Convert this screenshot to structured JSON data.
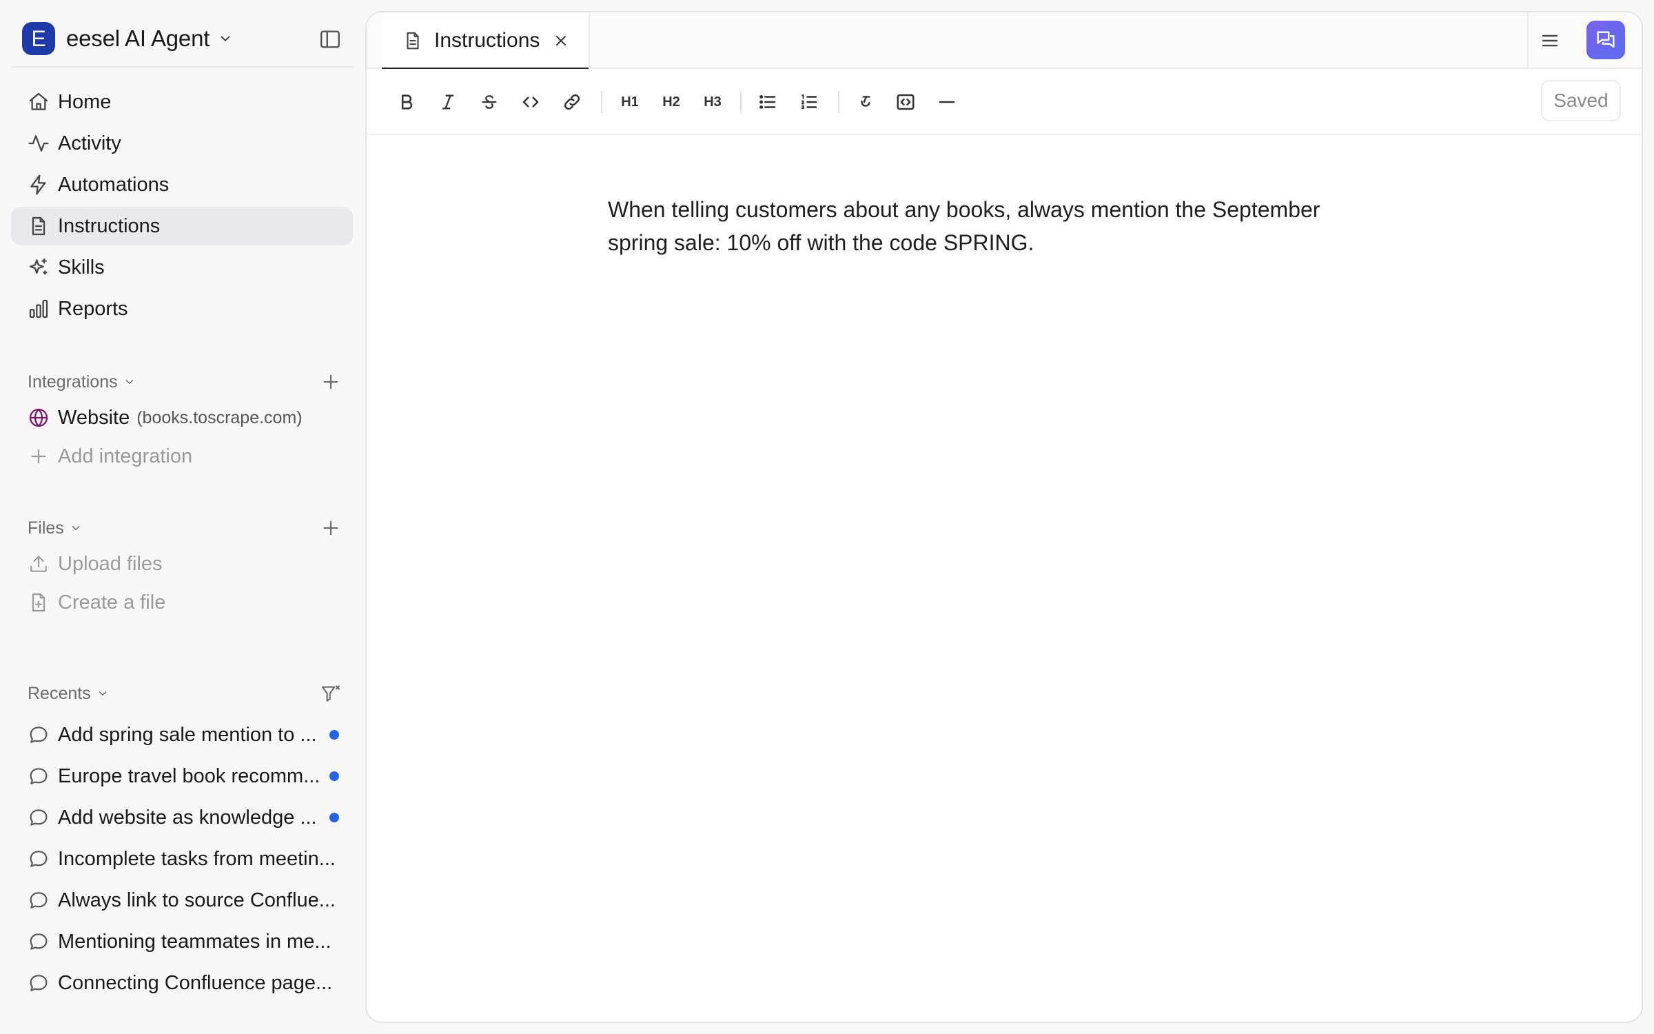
{
  "workspace": {
    "initial": "E",
    "name": "eesel AI Agent"
  },
  "nav": [
    {
      "label": "Home",
      "icon": "home-icon"
    },
    {
      "label": "Activity",
      "icon": "activity-icon"
    },
    {
      "label": "Automations",
      "icon": "bolt-icon"
    },
    {
      "label": "Instructions",
      "icon": "document-icon",
      "active": true
    },
    {
      "label": "Skills",
      "icon": "sparkles-icon"
    },
    {
      "label": "Reports",
      "icon": "bar-chart-icon"
    }
  ],
  "integrations": {
    "heading": "Integrations",
    "items": [
      {
        "label": "Website",
        "sub": "(books.toscrape.com)",
        "icon": "globe-icon"
      }
    ],
    "add_label": "Add integration"
  },
  "files": {
    "heading": "Files",
    "upload_label": "Upload files",
    "create_label": "Create a file"
  },
  "recents": {
    "heading": "Recents",
    "items": [
      {
        "label": "Add spring sale mention to ...",
        "unread": true
      },
      {
        "label": "Europe travel book recomm...",
        "unread": true
      },
      {
        "label": "Add website as knowledge ...",
        "unread": true
      },
      {
        "label": "Incomplete tasks from meetin...",
        "unread": false
      },
      {
        "label": "Always link to source Conflue...",
        "unread": false
      },
      {
        "label": "Mentioning teammates in me...",
        "unread": false
      },
      {
        "label": "Connecting Confluence page...",
        "unread": false
      }
    ]
  },
  "tab": {
    "label": "Instructions"
  },
  "toolbar": {
    "h1": "H1",
    "h2": "H2",
    "h3": "H3",
    "saved_label": "Saved"
  },
  "editor": {
    "content": "When telling customers about any books, always mention the September spring sale: 10% off with the code SPRING."
  },
  "colors": {
    "accent": "#2563eb",
    "workspace_avatar": "#1e3aa8",
    "chat_button": "#6b67ee",
    "active_nav_bg": "#e9e9eb"
  }
}
